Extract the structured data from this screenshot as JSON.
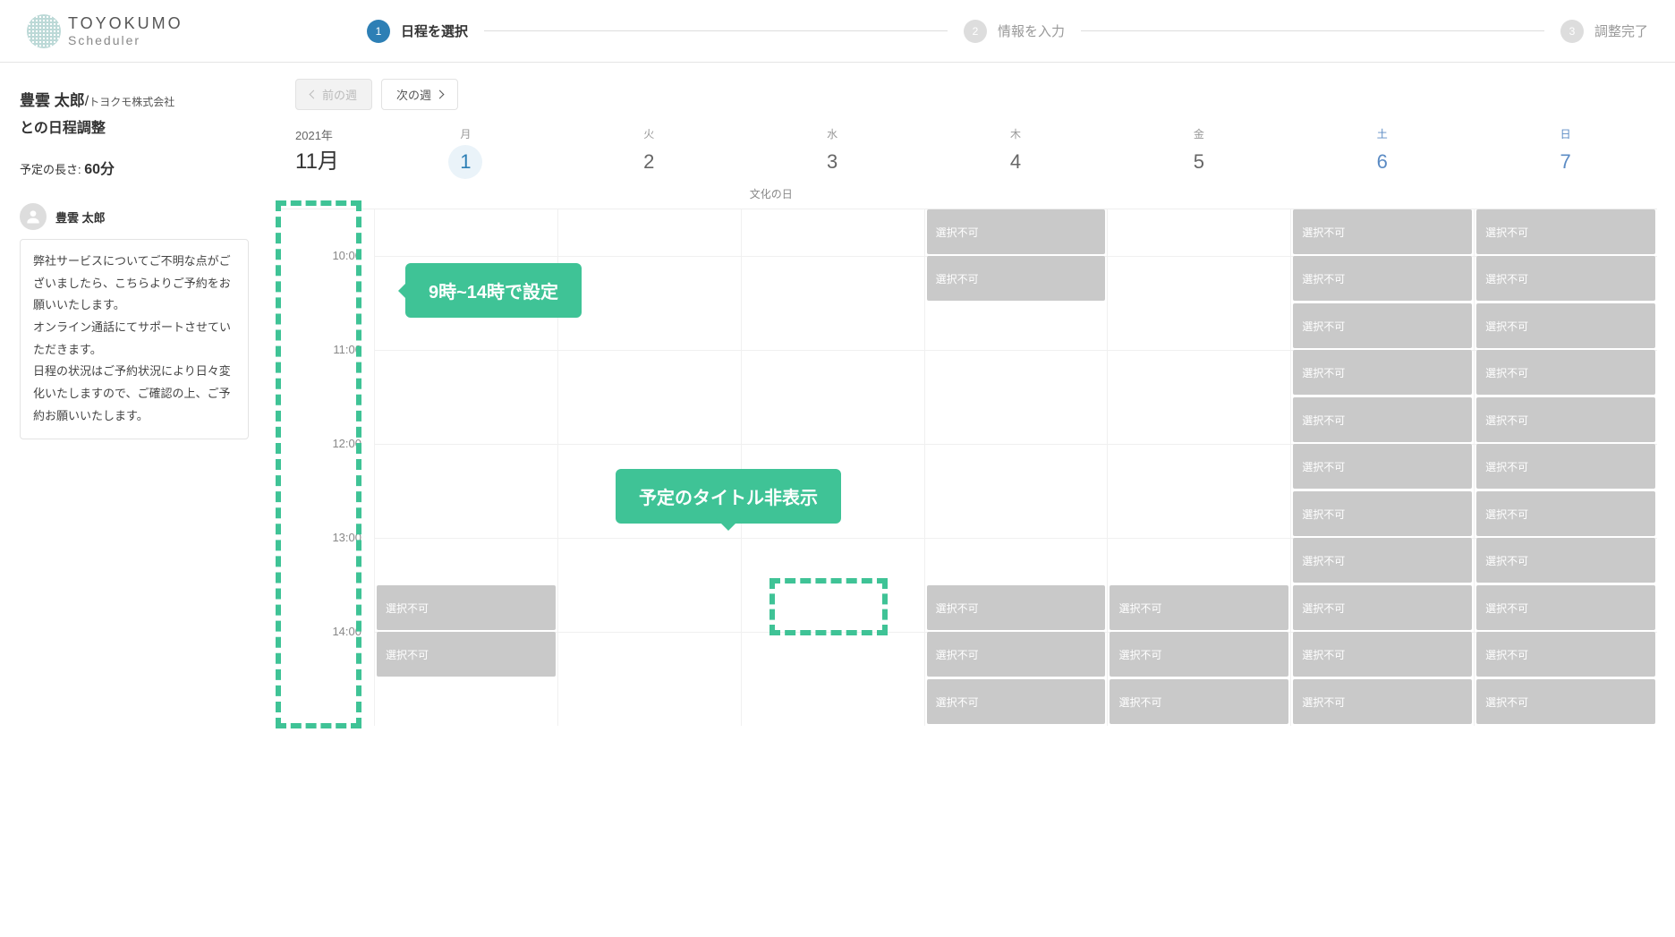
{
  "brand": {
    "name": "TOYOKUMO",
    "sub": "Scheduler"
  },
  "steps": [
    {
      "num": "1",
      "label": "日程を選択",
      "active": true
    },
    {
      "num": "2",
      "label": "情報を入力",
      "active": false
    },
    {
      "num": "3",
      "label": "調整完了",
      "active": false
    }
  ],
  "host": {
    "name": "豊雲 太郎",
    "company": "トヨクモ株式会社",
    "subtitle": "との日程調整"
  },
  "duration": {
    "label": "予定の長さ:",
    "value": "60分"
  },
  "user": {
    "name": "豊雲 太郎"
  },
  "message": "弊社サービスについてご不明な点がございましたら、こちらよりご予約をお願いいたします。\nオンライン通話にてサポートさせていただきます。\n日程の状況はご予約状況により日々変化いたしますので、ご確認の上、ご予約お願いいたします。",
  "nav": {
    "prev": "前の週",
    "next": "次の週"
  },
  "calendar": {
    "year": "2021年",
    "month": "11月",
    "days": [
      {
        "dow": "月",
        "num": "1",
        "today": true
      },
      {
        "dow": "火",
        "num": "2"
      },
      {
        "dow": "水",
        "num": "3",
        "holiday": "文化の日"
      },
      {
        "dow": "木",
        "num": "4"
      },
      {
        "dow": "金",
        "num": "5"
      },
      {
        "dow": "土",
        "num": "6",
        "cls": "sat"
      },
      {
        "dow": "日",
        "num": "7",
        "cls": "sun"
      }
    ],
    "times": [
      "",
      "10:00",
      "11:00",
      "12:00",
      "13:00",
      "14:00"
    ]
  },
  "slot_label": "選択不可",
  "slots": {
    "0": [
      420,
      472
    ],
    "3": [
      0,
      52,
      420,
      472,
      525
    ],
    "4": [
      420,
      472,
      525
    ],
    "5": [
      0,
      52,
      105,
      157,
      210,
      262,
      315,
      367,
      420,
      472,
      525
    ],
    "6": [
      0,
      52,
      105,
      157,
      210,
      262,
      315,
      367,
      420,
      472,
      525
    ]
  },
  "callouts": {
    "c1": "9時~14時で設定",
    "c2": "予定のタイトル非表示"
  }
}
